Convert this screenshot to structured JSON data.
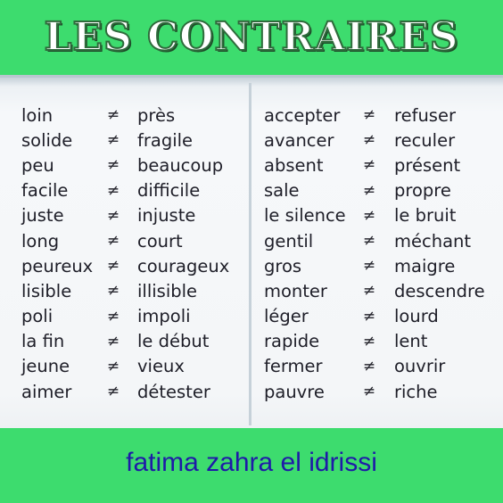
{
  "header": {
    "title": "LES CONTRAIRES"
  },
  "symbol": "≠",
  "left_pairs": [
    {
      "word": "loin",
      "opposite": "près"
    },
    {
      "word": "solide",
      "opposite": "fragile"
    },
    {
      "word": "peu",
      "opposite": "beaucoup"
    },
    {
      "word": "facile",
      "opposite": "difficile"
    },
    {
      "word": "juste",
      "opposite": "injuste"
    },
    {
      "word": "long",
      "opposite": "court"
    },
    {
      "word": "peureux",
      "opposite": "courageux"
    },
    {
      "word": "lisible",
      "opposite": "illisible"
    },
    {
      "word": "poli",
      "opposite": "impoli"
    },
    {
      "word": "la fin",
      "opposite": "le début"
    },
    {
      "word": "jeune",
      "opposite": "vieux"
    },
    {
      "word": "aimer",
      "opposite": "détester"
    }
  ],
  "right_pairs": [
    {
      "word": "accepter",
      "opposite": "refuser"
    },
    {
      "word": "avancer",
      "opposite": "reculer"
    },
    {
      "word": "absent",
      "opposite": "présent"
    },
    {
      "word": "sale",
      "opposite": "propre"
    },
    {
      "word": "le silence",
      "opposite": "le bruit"
    },
    {
      "word": "gentil",
      "opposite": "méchant"
    },
    {
      "word": "gros",
      "opposite": "maigre"
    },
    {
      "word": "monter",
      "opposite": "descendre"
    },
    {
      "word": "léger",
      "opposite": "lourd"
    },
    {
      "word": "rapide",
      "opposite": "lent"
    },
    {
      "word": "fermer",
      "opposite": "ouvrir"
    },
    {
      "word": "pauvre",
      "opposite": "riche"
    }
  ],
  "footer": {
    "author": "fatima zahra el idrissi"
  },
  "colors": {
    "banner": "#3ddc6e",
    "author_text": "#1f1aa8",
    "board": "#f4f6f8"
  }
}
